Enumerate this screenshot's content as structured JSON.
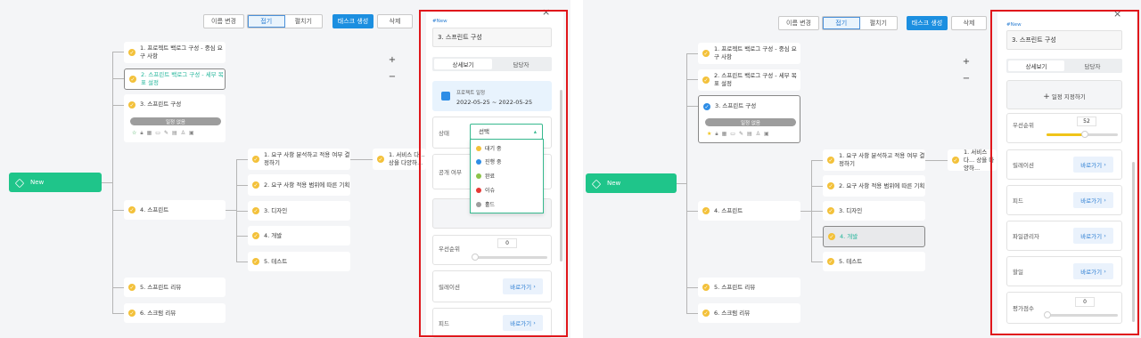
{
  "toolbar": {
    "rename": "이름 변경",
    "collapse": "접기",
    "expand": "펼치기",
    "create_task": "태스크 생성",
    "delete": "삭제"
  },
  "zoom": {
    "plus": "+",
    "minus": "−"
  },
  "root_label": "New",
  "nodes": {
    "n1": "1. 프로젝트 백로그 구성 - 중심 요구 사항",
    "n2": "2. 스프린트 백로그 구성 - 세부 목표 설정",
    "n3": "3. 스프린트 구성",
    "n4": "4. 스프린트",
    "n5": "5. 스프린트 리뷰",
    "n6": "6. 스크럼 리뷰",
    "s1": "1. 요구 사항 분석하고 적용 여부 결정하기",
    "s2": "2. 요구 사항 적용 범위에 따른 기획",
    "s3": "3. 디자인",
    "s4": "4. 개발",
    "s5": "5. 테스트",
    "t1": "1. 서비스 다... 상을 다양하...",
    "no_schedule": "일정 없음"
  },
  "panel": {
    "tag": "#New",
    "title": "3. 스프린트 구성",
    "tab_detail": "상세보기",
    "tab_assignee": "담당자",
    "close": "×",
    "schedule_label": "프로젝트 일정",
    "schedule_range": "2022-05-25 ~ 2022-05-25",
    "set_schedule": "일정 지정하기",
    "status_label": "상태",
    "status_select": "선택",
    "public_label": "공개 여부",
    "status_options": [
      {
        "label": "대기 중",
        "color": "#f3c13a"
      },
      {
        "label": "진행 중",
        "color": "#2d8de6"
      },
      {
        "label": "완료",
        "color": "#8bc34a"
      },
      {
        "label": "이슈",
        "color": "#e53935"
      },
      {
        "label": "홀드",
        "color": "#9e9e9e"
      }
    ],
    "priority_label": "우선순위",
    "priority_left": "0",
    "priority_right": "52",
    "relation_label": "릴레이션",
    "feed_label": "피드",
    "file_label": "파일관리자",
    "todo_label": "할일",
    "eval_label": "평가점수",
    "eval_value": "0",
    "go": "바로가기",
    "go_arrow": "›"
  },
  "colors": {
    "accent": "#1c8fe0",
    "root": "#1fc58a",
    "highlight": "#e0161b",
    "pending": "#f3c13a"
  }
}
